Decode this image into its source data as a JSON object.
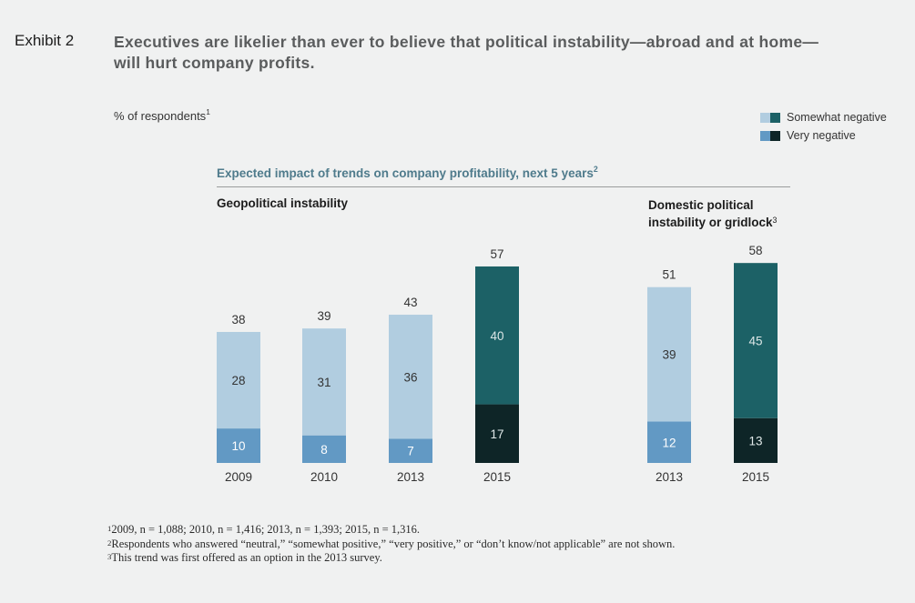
{
  "exhibit_label": "Exhibit 2",
  "headline": "Executives are likelier than ever to believe that political instability—abroad and at home—will hurt company profits.",
  "unit_label": "% of respondents",
  "unit_label_footnote": "1",
  "legend": [
    {
      "label": "Somewhat negative",
      "colors": [
        "#b1cde0",
        "#1c6166"
      ]
    },
    {
      "label": "Very negative",
      "colors": [
        "#6299c4",
        "#0e2527"
      ]
    }
  ],
  "chart_data": {
    "type": "bar",
    "stacked": true,
    "title": "Expected impact of trends on company profitability, next 5 years",
    "title_footnote": "2",
    "ylabel": "% of respondents",
    "ylim": [
      0,
      60
    ],
    "grid": false,
    "legend_position": "top-right",
    "groups": [
      {
        "title": "Geopolitical instability",
        "title_footnote": "",
        "categories": [
          "2009",
          "2010",
          "2013",
          "2015"
        ],
        "series": [
          {
            "name": "Very negative",
            "values": [
              10,
              8,
              7,
              17
            ]
          },
          {
            "name": "Somewhat negative",
            "values": [
              28,
              31,
              36,
              40
            ]
          }
        ],
        "totals": [
          38,
          39,
          43,
          57
        ],
        "highlight": [
          false,
          false,
          false,
          true
        ]
      },
      {
        "title": "Domestic political instability or gridlock",
        "title_line1": "Domestic political",
        "title_line2": "instability or gridlock",
        "title_footnote": "3",
        "categories": [
          "2013",
          "2015"
        ],
        "series": [
          {
            "name": "Very negative",
            "values": [
              12,
              13
            ]
          },
          {
            "name": "Somewhat negative",
            "values": [
              39,
              45
            ]
          }
        ],
        "totals": [
          51,
          58
        ],
        "highlight": [
          false,
          true
        ]
      }
    ],
    "colors": {
      "somewhat_negative": "#b1cde0",
      "very_negative": "#6299c4",
      "somewhat_negative_highlight": "#1c6166",
      "very_negative_highlight": "#0e2527"
    }
  },
  "footnotes": [
    {
      "mark": "1",
      "text": "2009, n = 1,088; 2010, n = 1,416; 2013, n = 1,393; 2015, n = 1,316."
    },
    {
      "mark": "2",
      "text": "Respondents who answered “neutral,” “somewhat positive,” “very positive,” or “don’t know/not applicable” are not shown."
    },
    {
      "mark": "3",
      "text": "This trend was first offered as an option in the 2013 survey."
    }
  ]
}
